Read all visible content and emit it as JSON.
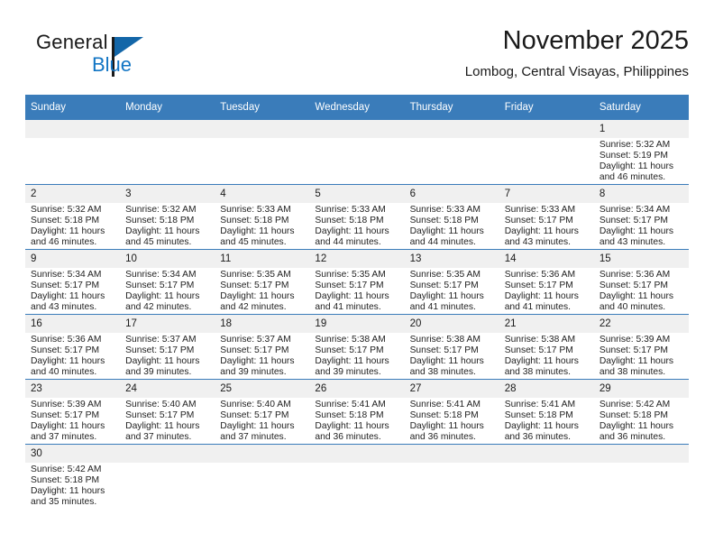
{
  "brand": {
    "name_part1": "General",
    "name_part2": "Blue",
    "logo_icon": "blue-triangle-logo",
    "accent_color": "#1366a8"
  },
  "header": {
    "title": "November 2025",
    "subtitle": "Lombog, Central Visayas, Philippines"
  },
  "theme": {
    "header_blue": "#3a7cba",
    "daynum_band": "#f0f0f0",
    "text": "#222222"
  },
  "weekday_headers": [
    "Sunday",
    "Monday",
    "Tuesday",
    "Wednesday",
    "Thursday",
    "Friday",
    "Saturday"
  ],
  "labels": {
    "sunrise": "Sunrise:",
    "sunset": "Sunset:",
    "daylight": "Daylight:"
  },
  "weeks": [
    [
      {
        "day": "",
        "sunrise": "",
        "sunset": "",
        "daylight_line1": "",
        "daylight_line2": ""
      },
      {
        "day": "",
        "sunrise": "",
        "sunset": "",
        "daylight_line1": "",
        "daylight_line2": ""
      },
      {
        "day": "",
        "sunrise": "",
        "sunset": "",
        "daylight_line1": "",
        "daylight_line2": ""
      },
      {
        "day": "",
        "sunrise": "",
        "sunset": "",
        "daylight_line1": "",
        "daylight_line2": ""
      },
      {
        "day": "",
        "sunrise": "",
        "sunset": "",
        "daylight_line1": "",
        "daylight_line2": ""
      },
      {
        "day": "",
        "sunrise": "",
        "sunset": "",
        "daylight_line1": "",
        "daylight_line2": ""
      },
      {
        "day": "1",
        "sunrise": "Sunrise: 5:32 AM",
        "sunset": "Sunset: 5:19 PM",
        "daylight_line1": "Daylight: 11 hours",
        "daylight_line2": "and 46 minutes."
      }
    ],
    [
      {
        "day": "2",
        "sunrise": "Sunrise: 5:32 AM",
        "sunset": "Sunset: 5:18 PM",
        "daylight_line1": "Daylight: 11 hours",
        "daylight_line2": "and 46 minutes."
      },
      {
        "day": "3",
        "sunrise": "Sunrise: 5:32 AM",
        "sunset": "Sunset: 5:18 PM",
        "daylight_line1": "Daylight: 11 hours",
        "daylight_line2": "and 45 minutes."
      },
      {
        "day": "4",
        "sunrise": "Sunrise: 5:33 AM",
        "sunset": "Sunset: 5:18 PM",
        "daylight_line1": "Daylight: 11 hours",
        "daylight_line2": "and 45 minutes."
      },
      {
        "day": "5",
        "sunrise": "Sunrise: 5:33 AM",
        "sunset": "Sunset: 5:18 PM",
        "daylight_line1": "Daylight: 11 hours",
        "daylight_line2": "and 44 minutes."
      },
      {
        "day": "6",
        "sunrise": "Sunrise: 5:33 AM",
        "sunset": "Sunset: 5:18 PM",
        "daylight_line1": "Daylight: 11 hours",
        "daylight_line2": "and 44 minutes."
      },
      {
        "day": "7",
        "sunrise": "Sunrise: 5:33 AM",
        "sunset": "Sunset: 5:17 PM",
        "daylight_line1": "Daylight: 11 hours",
        "daylight_line2": "and 43 minutes."
      },
      {
        "day": "8",
        "sunrise": "Sunrise: 5:34 AM",
        "sunset": "Sunset: 5:17 PM",
        "daylight_line1": "Daylight: 11 hours",
        "daylight_line2": "and 43 minutes."
      }
    ],
    [
      {
        "day": "9",
        "sunrise": "Sunrise: 5:34 AM",
        "sunset": "Sunset: 5:17 PM",
        "daylight_line1": "Daylight: 11 hours",
        "daylight_line2": "and 43 minutes."
      },
      {
        "day": "10",
        "sunrise": "Sunrise: 5:34 AM",
        "sunset": "Sunset: 5:17 PM",
        "daylight_line1": "Daylight: 11 hours",
        "daylight_line2": "and 42 minutes."
      },
      {
        "day": "11",
        "sunrise": "Sunrise: 5:35 AM",
        "sunset": "Sunset: 5:17 PM",
        "daylight_line1": "Daylight: 11 hours",
        "daylight_line2": "and 42 minutes."
      },
      {
        "day": "12",
        "sunrise": "Sunrise: 5:35 AM",
        "sunset": "Sunset: 5:17 PM",
        "daylight_line1": "Daylight: 11 hours",
        "daylight_line2": "and 41 minutes."
      },
      {
        "day": "13",
        "sunrise": "Sunrise: 5:35 AM",
        "sunset": "Sunset: 5:17 PM",
        "daylight_line1": "Daylight: 11 hours",
        "daylight_line2": "and 41 minutes."
      },
      {
        "day": "14",
        "sunrise": "Sunrise: 5:36 AM",
        "sunset": "Sunset: 5:17 PM",
        "daylight_line1": "Daylight: 11 hours",
        "daylight_line2": "and 41 minutes."
      },
      {
        "day": "15",
        "sunrise": "Sunrise: 5:36 AM",
        "sunset": "Sunset: 5:17 PM",
        "daylight_line1": "Daylight: 11 hours",
        "daylight_line2": "and 40 minutes."
      }
    ],
    [
      {
        "day": "16",
        "sunrise": "Sunrise: 5:36 AM",
        "sunset": "Sunset: 5:17 PM",
        "daylight_line1": "Daylight: 11 hours",
        "daylight_line2": "and 40 minutes."
      },
      {
        "day": "17",
        "sunrise": "Sunrise: 5:37 AM",
        "sunset": "Sunset: 5:17 PM",
        "daylight_line1": "Daylight: 11 hours",
        "daylight_line2": "and 39 minutes."
      },
      {
        "day": "18",
        "sunrise": "Sunrise: 5:37 AM",
        "sunset": "Sunset: 5:17 PM",
        "daylight_line1": "Daylight: 11 hours",
        "daylight_line2": "and 39 minutes."
      },
      {
        "day": "19",
        "sunrise": "Sunrise: 5:38 AM",
        "sunset": "Sunset: 5:17 PM",
        "daylight_line1": "Daylight: 11 hours",
        "daylight_line2": "and 39 minutes."
      },
      {
        "day": "20",
        "sunrise": "Sunrise: 5:38 AM",
        "sunset": "Sunset: 5:17 PM",
        "daylight_line1": "Daylight: 11 hours",
        "daylight_line2": "and 38 minutes."
      },
      {
        "day": "21",
        "sunrise": "Sunrise: 5:38 AM",
        "sunset": "Sunset: 5:17 PM",
        "daylight_line1": "Daylight: 11 hours",
        "daylight_line2": "and 38 minutes."
      },
      {
        "day": "22",
        "sunrise": "Sunrise: 5:39 AM",
        "sunset": "Sunset: 5:17 PM",
        "daylight_line1": "Daylight: 11 hours",
        "daylight_line2": "and 38 minutes."
      }
    ],
    [
      {
        "day": "23",
        "sunrise": "Sunrise: 5:39 AM",
        "sunset": "Sunset: 5:17 PM",
        "daylight_line1": "Daylight: 11 hours",
        "daylight_line2": "and 37 minutes."
      },
      {
        "day": "24",
        "sunrise": "Sunrise: 5:40 AM",
        "sunset": "Sunset: 5:17 PM",
        "daylight_line1": "Daylight: 11 hours",
        "daylight_line2": "and 37 minutes."
      },
      {
        "day": "25",
        "sunrise": "Sunrise: 5:40 AM",
        "sunset": "Sunset: 5:17 PM",
        "daylight_line1": "Daylight: 11 hours",
        "daylight_line2": "and 37 minutes."
      },
      {
        "day": "26",
        "sunrise": "Sunrise: 5:41 AM",
        "sunset": "Sunset: 5:18 PM",
        "daylight_line1": "Daylight: 11 hours",
        "daylight_line2": "and 36 minutes."
      },
      {
        "day": "27",
        "sunrise": "Sunrise: 5:41 AM",
        "sunset": "Sunset: 5:18 PM",
        "daylight_line1": "Daylight: 11 hours",
        "daylight_line2": "and 36 minutes."
      },
      {
        "day": "28",
        "sunrise": "Sunrise: 5:41 AM",
        "sunset": "Sunset: 5:18 PM",
        "daylight_line1": "Daylight: 11 hours",
        "daylight_line2": "and 36 minutes."
      },
      {
        "day": "29",
        "sunrise": "Sunrise: 5:42 AM",
        "sunset": "Sunset: 5:18 PM",
        "daylight_line1": "Daylight: 11 hours",
        "daylight_line2": "and 36 minutes."
      }
    ],
    [
      {
        "day": "30",
        "sunrise": "Sunrise: 5:42 AM",
        "sunset": "Sunset: 5:18 PM",
        "daylight_line1": "Daylight: 11 hours",
        "daylight_line2": "and 35 minutes."
      },
      {
        "day": "",
        "sunrise": "",
        "sunset": "",
        "daylight_line1": "",
        "daylight_line2": ""
      },
      {
        "day": "",
        "sunrise": "",
        "sunset": "",
        "daylight_line1": "",
        "daylight_line2": ""
      },
      {
        "day": "",
        "sunrise": "",
        "sunset": "",
        "daylight_line1": "",
        "daylight_line2": ""
      },
      {
        "day": "",
        "sunrise": "",
        "sunset": "",
        "daylight_line1": "",
        "daylight_line2": ""
      },
      {
        "day": "",
        "sunrise": "",
        "sunset": "",
        "daylight_line1": "",
        "daylight_line2": ""
      },
      {
        "day": "",
        "sunrise": "",
        "sunset": "",
        "daylight_line1": "",
        "daylight_line2": ""
      }
    ]
  ]
}
